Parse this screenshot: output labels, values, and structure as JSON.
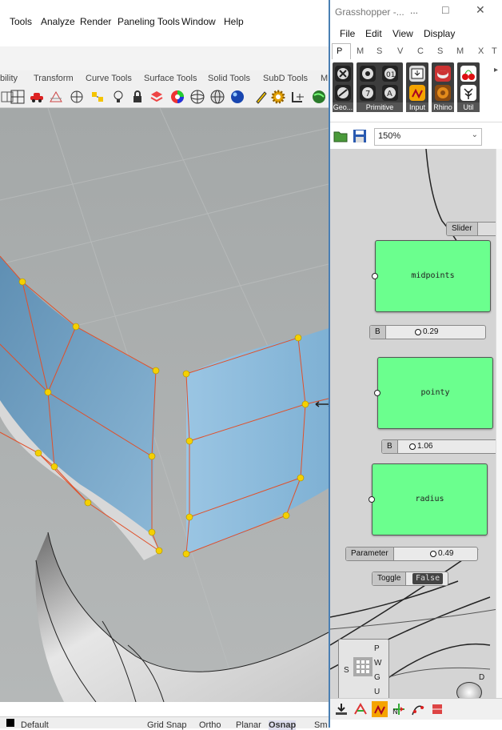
{
  "rhino": {
    "menu": [
      "Tools",
      "Analyze",
      "Render",
      "Paneling Tools",
      "Window",
      "Help"
    ],
    "tabs": [
      "bility",
      "Transform",
      "Curve Tools",
      "Surface Tools",
      "Solid Tools",
      "SubD Tools",
      "M"
    ],
    "toolbar_icons": [
      "boxes-icon",
      "grid-icon",
      "car-icon",
      "dimension-icon",
      "circle-target-icon",
      "lights-icon",
      "bulb-icon",
      "lock-icon",
      "layer-icon",
      "color-wheel-icon",
      "sphere-grid-icon",
      "sphere-wire-icon",
      "material-ball-icon",
      "pen-icon",
      "gear-gold-icon",
      "snap-icon",
      "globe-icon"
    ],
    "status": {
      "layer": "Default",
      "grid_snap": "Grid Snap",
      "ortho": "Ortho",
      "planar": "Planar",
      "osnap": "Osnap",
      "sm": "Sm"
    }
  },
  "grasshopper": {
    "title": "Grasshopper -...",
    "window_controls": [
      "...",
      "□",
      "✕"
    ],
    "menu": [
      "File",
      "Edit",
      "View",
      "Display"
    ],
    "tabs": [
      "P",
      "M",
      "S",
      "V",
      "C",
      "S",
      "M",
      "X",
      "T"
    ],
    "ribbon_groups": [
      "Geo...",
      "Primitive",
      "Input",
      "Rhino",
      "Util"
    ],
    "zoom": "150%",
    "components": {
      "slider_label": "Slider",
      "midpoints": "midpoints",
      "pointy": "pointy",
      "radius": "radius",
      "b1_tag": "B",
      "b1_value": "0.29",
      "b2_tag": "B",
      "b2_value": "1.06",
      "param_tag": "Parameter",
      "param_value": "0.49",
      "toggle_tag": "Toggle",
      "toggle_value": "False",
      "params_node_inputs": [
        "P",
        "W",
        "G",
        "U"
      ],
      "params_node_left": "S",
      "right_labels": [
        "D",
        "C"
      ]
    }
  },
  "colors": {
    "component_green": "#6bff8e",
    "surface_blue": "#86b9dc",
    "curve_red": "#e0502a",
    "point_yellow": "#f5d000",
    "gh_canvas": "#d4d4d4"
  }
}
